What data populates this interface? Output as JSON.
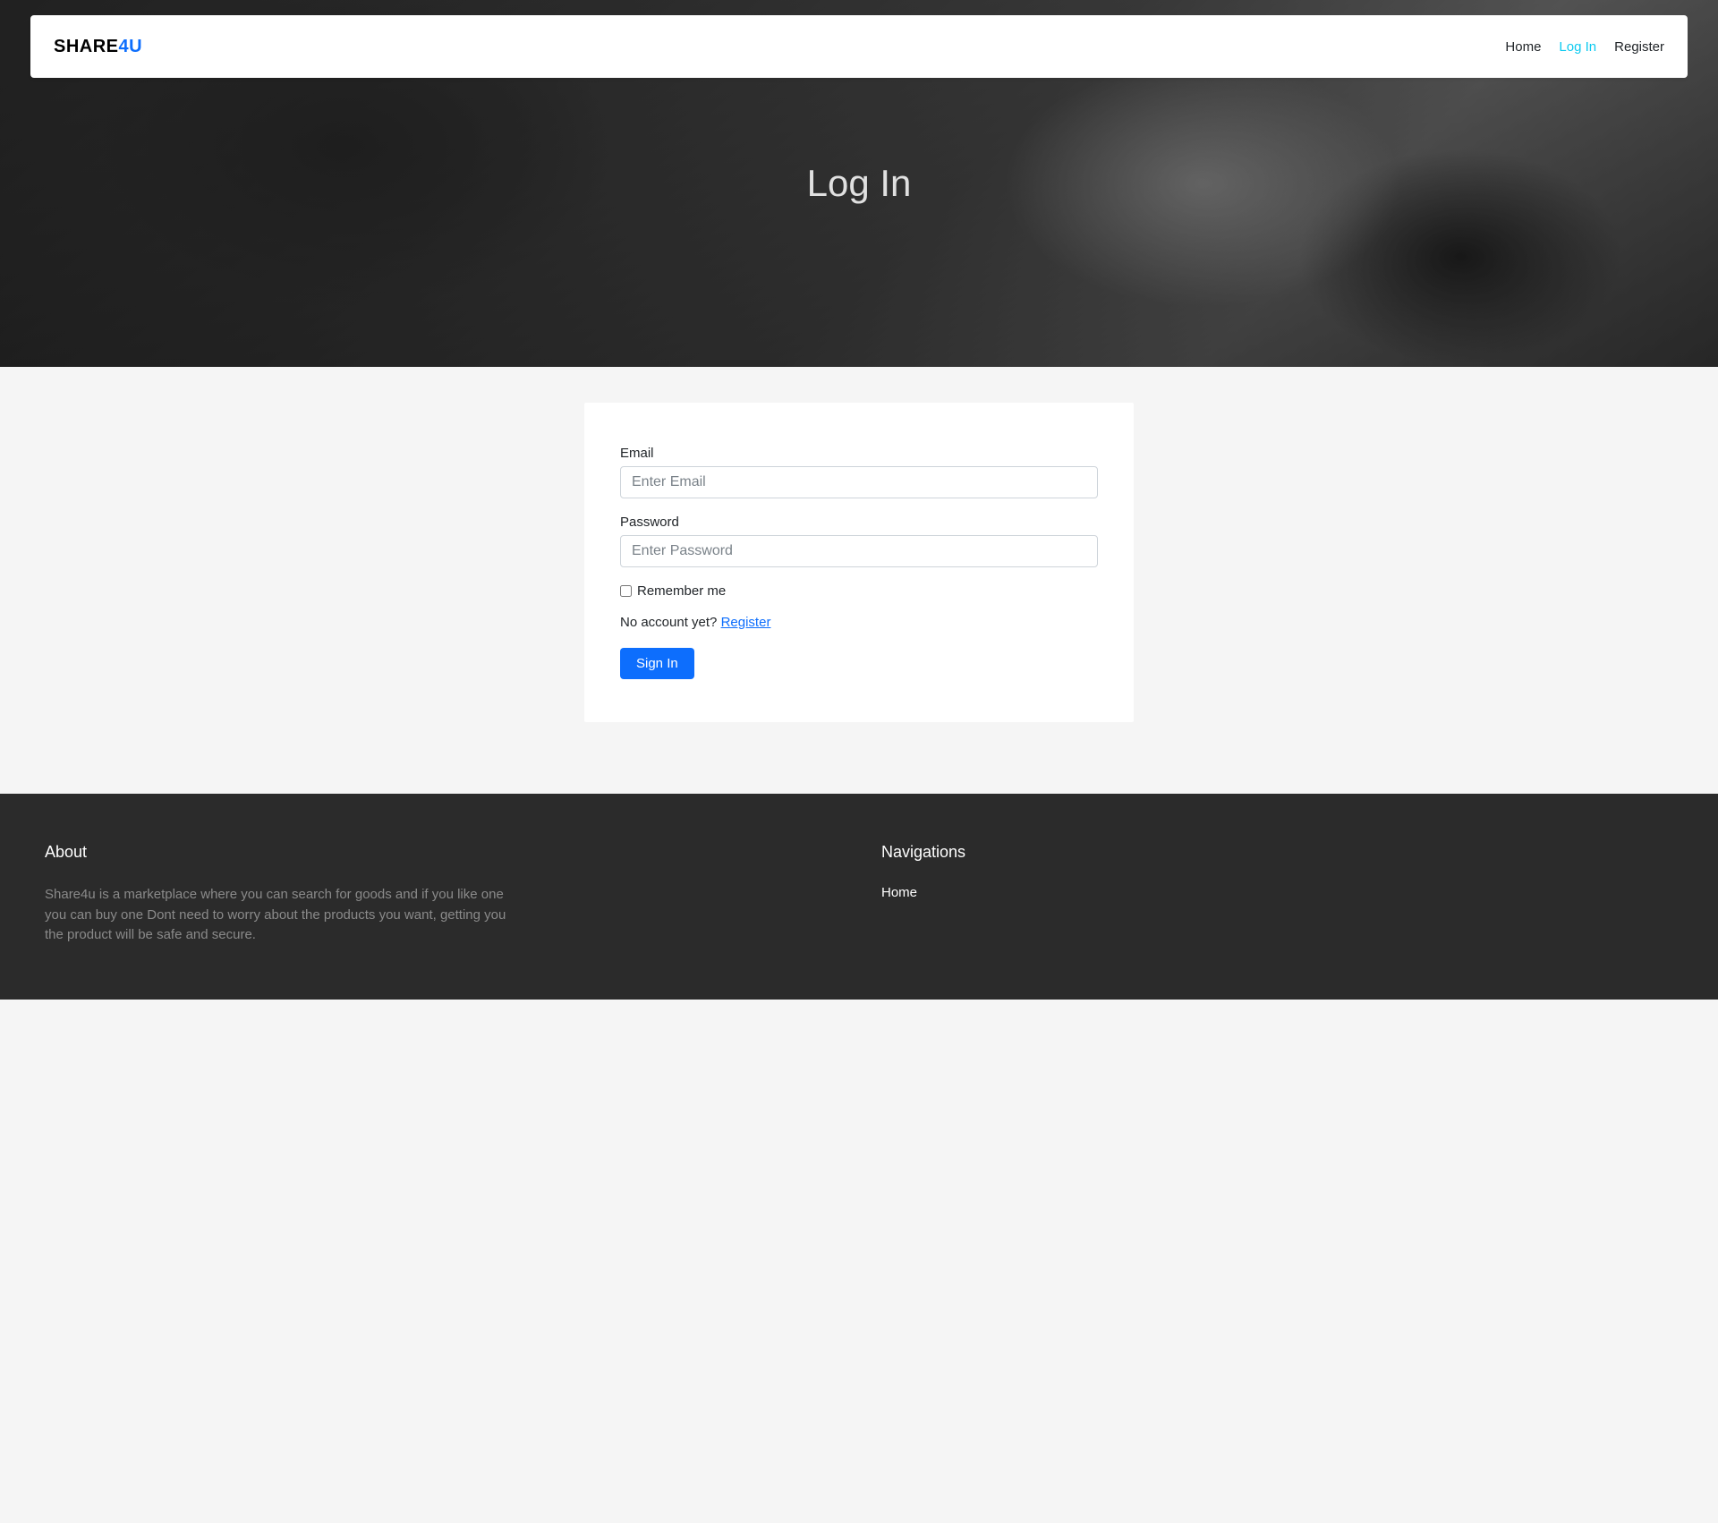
{
  "brand": {
    "part1": "SHARE",
    "part2": "4U"
  },
  "nav": {
    "home": "Home",
    "login": "Log In",
    "register": "Register"
  },
  "hero": {
    "title": "Log In"
  },
  "form": {
    "email_label": "Email",
    "email_placeholder": "Enter Email",
    "password_label": "Password",
    "password_placeholder": "Enter Password",
    "remember_label": "Remember me",
    "no_account_text": "No account yet? ",
    "register_link": "Register",
    "submit_label": "Sign In"
  },
  "footer": {
    "about_heading": "About",
    "about_text": "Share4u is a marketplace where you can search for goods and if you like one you can buy one Dont need to worry about the products you want, getting you the product will be safe and secure.",
    "nav_heading": "Navigations",
    "nav_home": "Home"
  }
}
